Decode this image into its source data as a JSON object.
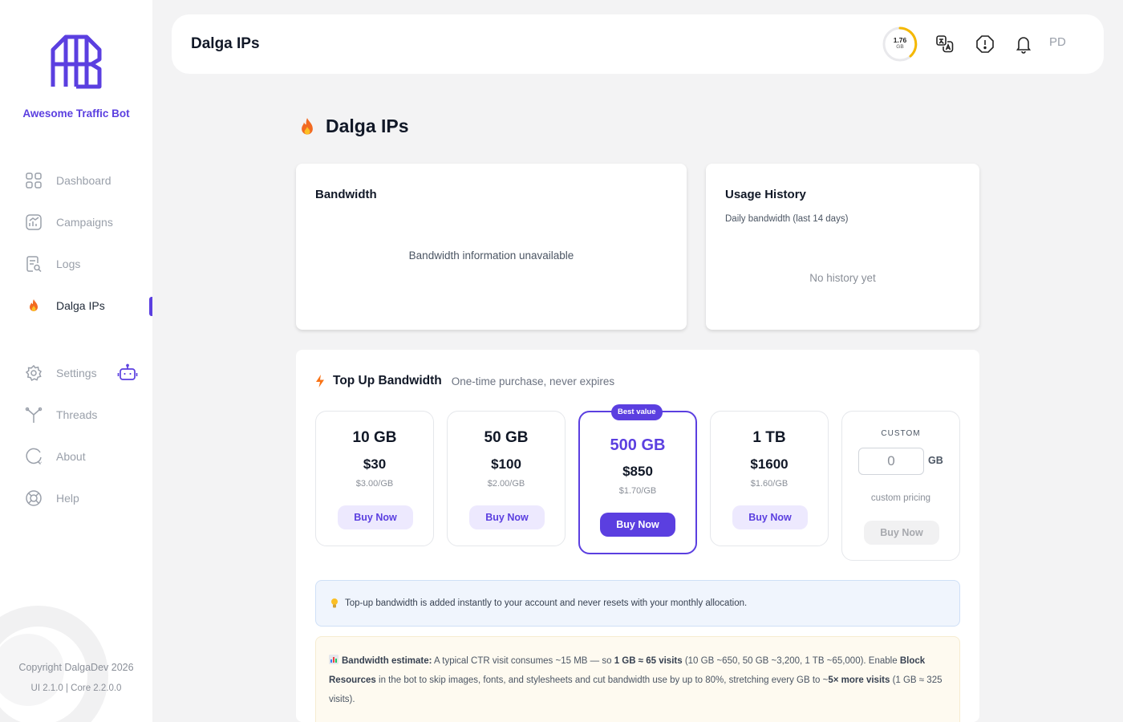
{
  "sidebar": {
    "brand": "Awesome Traffic Bot",
    "items": [
      {
        "label": "Dashboard",
        "icon": "dashboard-icon"
      },
      {
        "label": "Campaigns",
        "icon": "campaigns-icon"
      },
      {
        "label": "Logs",
        "icon": "logs-icon"
      },
      {
        "label": "Dalga IPs",
        "icon": "flame-icon",
        "active": true
      },
      {
        "label": "Settings",
        "icon": "gear-icon"
      },
      {
        "label": "Threads",
        "icon": "threads-icon"
      },
      {
        "label": "About",
        "icon": "about-icon"
      },
      {
        "label": "Help",
        "icon": "lifebuoy-icon"
      }
    ],
    "copyright": "Copyright DalgaDev 2026",
    "version": "UI 2.1.0 | Core 2.2.0.0"
  },
  "header": {
    "title": "Dalga IPs",
    "usage_value": "1.76",
    "usage_unit": "GB",
    "avatar": "PD"
  },
  "page": {
    "title": "Dalga IPs",
    "bandwidth": {
      "title": "Bandwidth",
      "message": "Bandwidth information unavailable"
    },
    "usage_history": {
      "title": "Usage History",
      "subtitle": "Daily bandwidth (last 14 days)",
      "message": "No history yet"
    },
    "topup": {
      "title": "Top Up Bandwidth",
      "subtitle": "One-time purchase, never expires",
      "plans": [
        {
          "size": "10 GB",
          "price": "$30",
          "per": "$3.00/GB",
          "buy": "Buy Now"
        },
        {
          "size": "50 GB",
          "price": "$100",
          "per": "$2.00/GB",
          "buy": "Buy Now"
        },
        {
          "size": "500 GB",
          "price": "$850",
          "per": "$1.70/GB",
          "buy": "Buy Now",
          "badge": "Best value"
        },
        {
          "size": "1 TB",
          "price": "$1600",
          "per": "$1.60/GB",
          "buy": "Buy Now"
        }
      ],
      "custom": {
        "label": "CUSTOM",
        "value": "0",
        "unit": "GB",
        "note": "custom pricing",
        "buy": "Buy Now"
      },
      "info": "Top-up bandwidth is added instantly to your account and never resets with your monthly allocation.",
      "estimate": {
        "label": "Bandwidth estimate:",
        "text1": "A typical CTR visit consumes ~15 MB — so",
        "strong1": "1 GB ≈ 65 visits",
        "text2": "(10 GB ~650, 50 GB ~3,200, 1 TB ~65,000). Enable",
        "strong2": "Block Resources",
        "text3": "in the bot to skip images, fonts, and stylesheets and cut bandwidth use by up to 80%, stretching every GB to ~",
        "strong3": "5× more visits",
        "text4": "(1 GB ≈ 325 visits)."
      }
    }
  },
  "colors": {
    "accent": "#5b3fe0",
    "ring": "#f5b800",
    "background": "#f3f3f4"
  }
}
